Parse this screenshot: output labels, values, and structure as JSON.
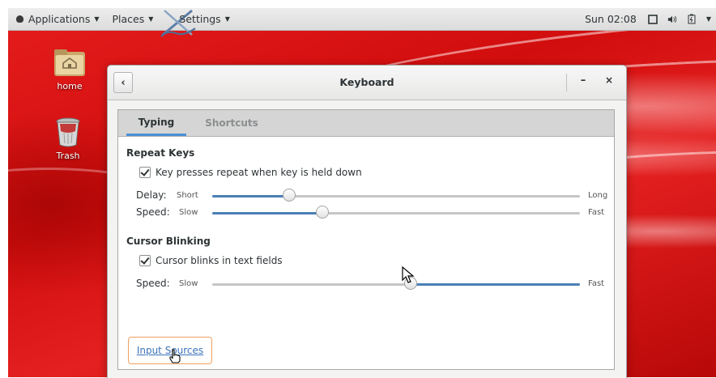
{
  "top_panel": {
    "applications": "Applications",
    "places": "Places",
    "settings": "Settings",
    "clock": "Sun 02:08"
  },
  "desktop": {
    "icons": [
      {
        "label": "home"
      },
      {
        "label": "Trash"
      }
    ]
  },
  "window": {
    "title": "Keyboard",
    "minimize": "–",
    "close": "×",
    "tabs": [
      {
        "label": "Typing",
        "active": true
      },
      {
        "label": "Shortcuts",
        "active": false
      }
    ],
    "repeat_keys": {
      "title": "Repeat Keys",
      "checkbox_label": "Key presses repeat when key is held down",
      "checked": true,
      "delay": {
        "label": "Delay:",
        "min": "Short",
        "max": "Long",
        "value": 0.21
      },
      "speed": {
        "label": "Speed:",
        "min": "Slow",
        "max": "Fast",
        "value": 0.3
      }
    },
    "cursor_blinking": {
      "title": "Cursor Blinking",
      "checkbox_label": "Cursor blinks in text fields",
      "checked": true,
      "speed": {
        "label": "Speed:",
        "min": "Slow",
        "max": "Fast",
        "value": 0.54
      }
    },
    "input_sources_link": "Input Sources"
  },
  "colors": {
    "accent": "#4a7fb5",
    "desktop_red": "#d10d0d",
    "link": "#3b73b9"
  }
}
